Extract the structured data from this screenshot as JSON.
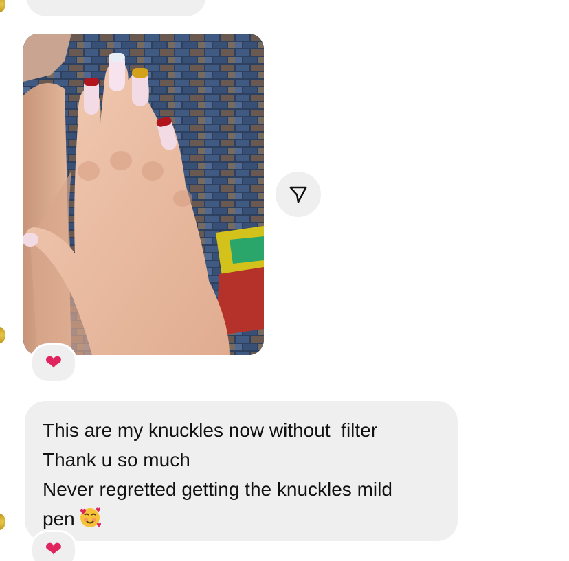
{
  "message": {
    "lines": [
      "This are my knuckles now without  filter",
      "Thank u so much",
      "Never regretted getting the knuckles mild",
      "pen"
    ],
    "emoji": "smiling-face-with-hearts"
  },
  "reactions": {
    "photo": "❤",
    "message": "❤"
  },
  "icons": {
    "share": "paper-plane-icon"
  },
  "colors": {
    "bubble": "#efefef",
    "heart": "#e0245e",
    "text": "#111111"
  }
}
